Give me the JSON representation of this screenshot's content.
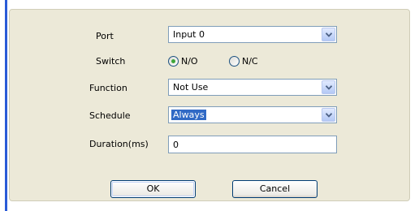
{
  "form": {
    "port": {
      "label": "Port",
      "value": "Input 0"
    },
    "switch": {
      "label": "Switch",
      "options": [
        {
          "label": "N/O",
          "selected": true
        },
        {
          "label": "N/C",
          "selected": false
        }
      ]
    },
    "function": {
      "label": "Function",
      "value": "Not Use"
    },
    "schedule": {
      "label": "Schedule",
      "value": "Always"
    },
    "duration": {
      "label": "Duration(ms)",
      "value": "0"
    }
  },
  "buttons": {
    "ok_label": "OK",
    "cancel_label": "Cancel"
  },
  "colors": {
    "accent": "#2a5bd7",
    "panel": "#ece9d8",
    "selection": "#316ac5",
    "radio_dot": "#3ea63a"
  },
  "icons": {
    "dropdown": "chevron-down-icon",
    "radio_selected": "radio-selected-icon",
    "radio_unselected": "radio-unselected-icon"
  }
}
